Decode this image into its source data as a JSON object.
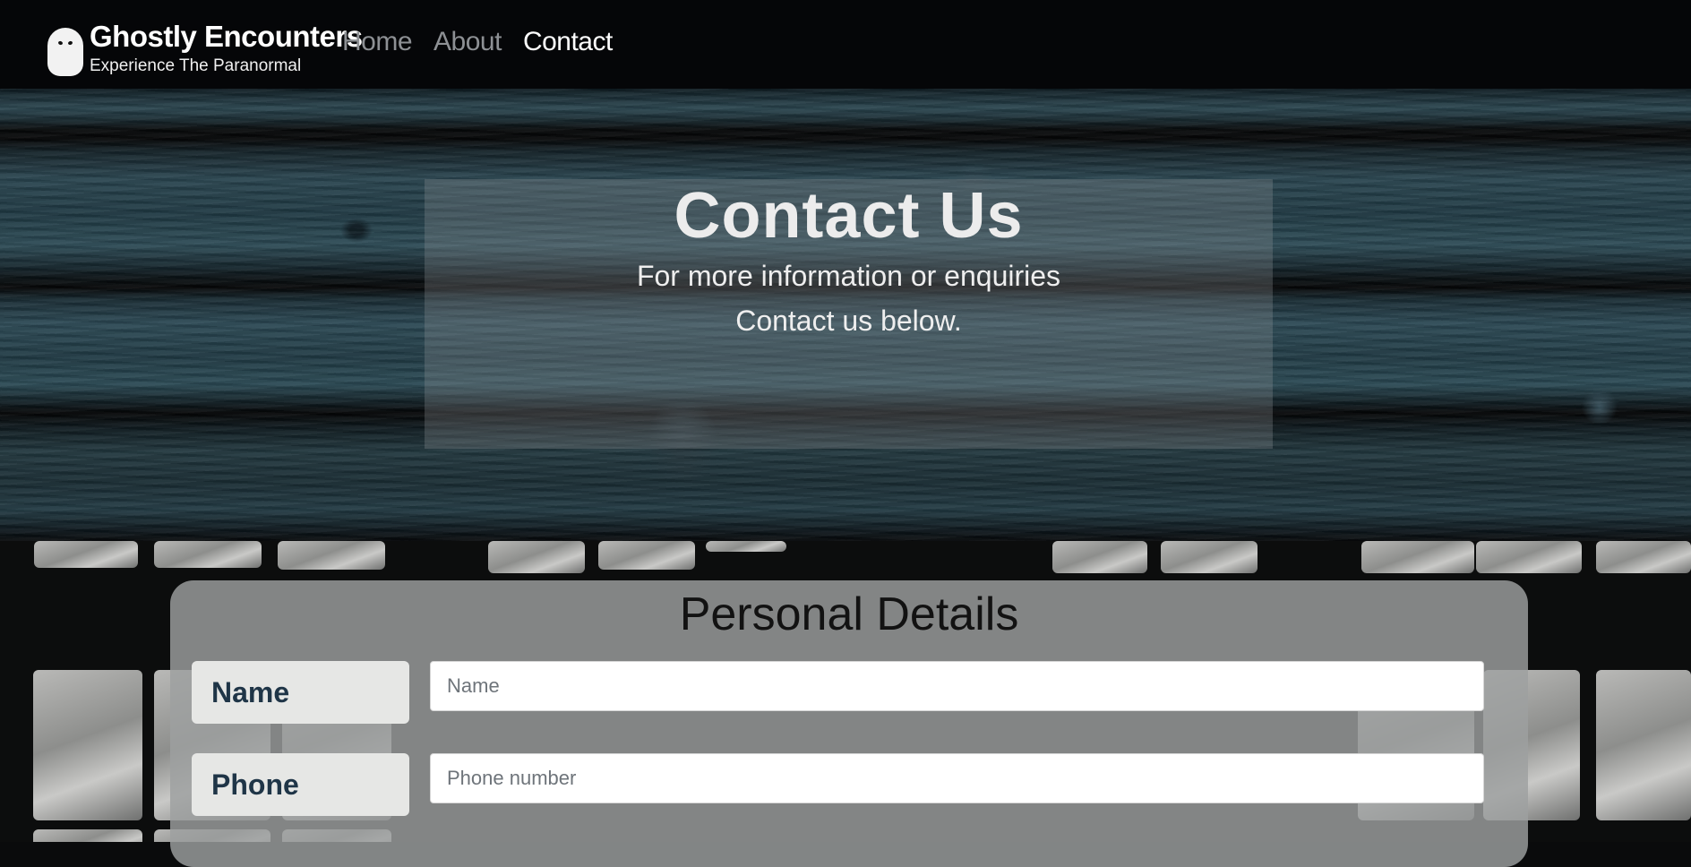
{
  "brand": {
    "title": "Ghostly Encounters",
    "subtitle": "Experience The Paranormal",
    "logo_icon": "ghost-icon"
  },
  "nav": {
    "links": [
      {
        "label": "Home",
        "active": false
      },
      {
        "label": "About",
        "active": false
      },
      {
        "label": "Contact",
        "active": true
      }
    ]
  },
  "hero": {
    "title": "Contact Us",
    "line1": "For more information or enquiries",
    "line2": "Contact us below."
  },
  "form": {
    "section_title": "Personal Details",
    "name_label": "Name",
    "name_placeholder": "Name",
    "phone_label": "Phone",
    "phone_placeholder": "Phone number"
  },
  "colors": {
    "navbar_bg": "#050608",
    "nav_active": "#ffffff",
    "nav_inactive": "#8d9094",
    "label_text": "#1f3547"
  }
}
